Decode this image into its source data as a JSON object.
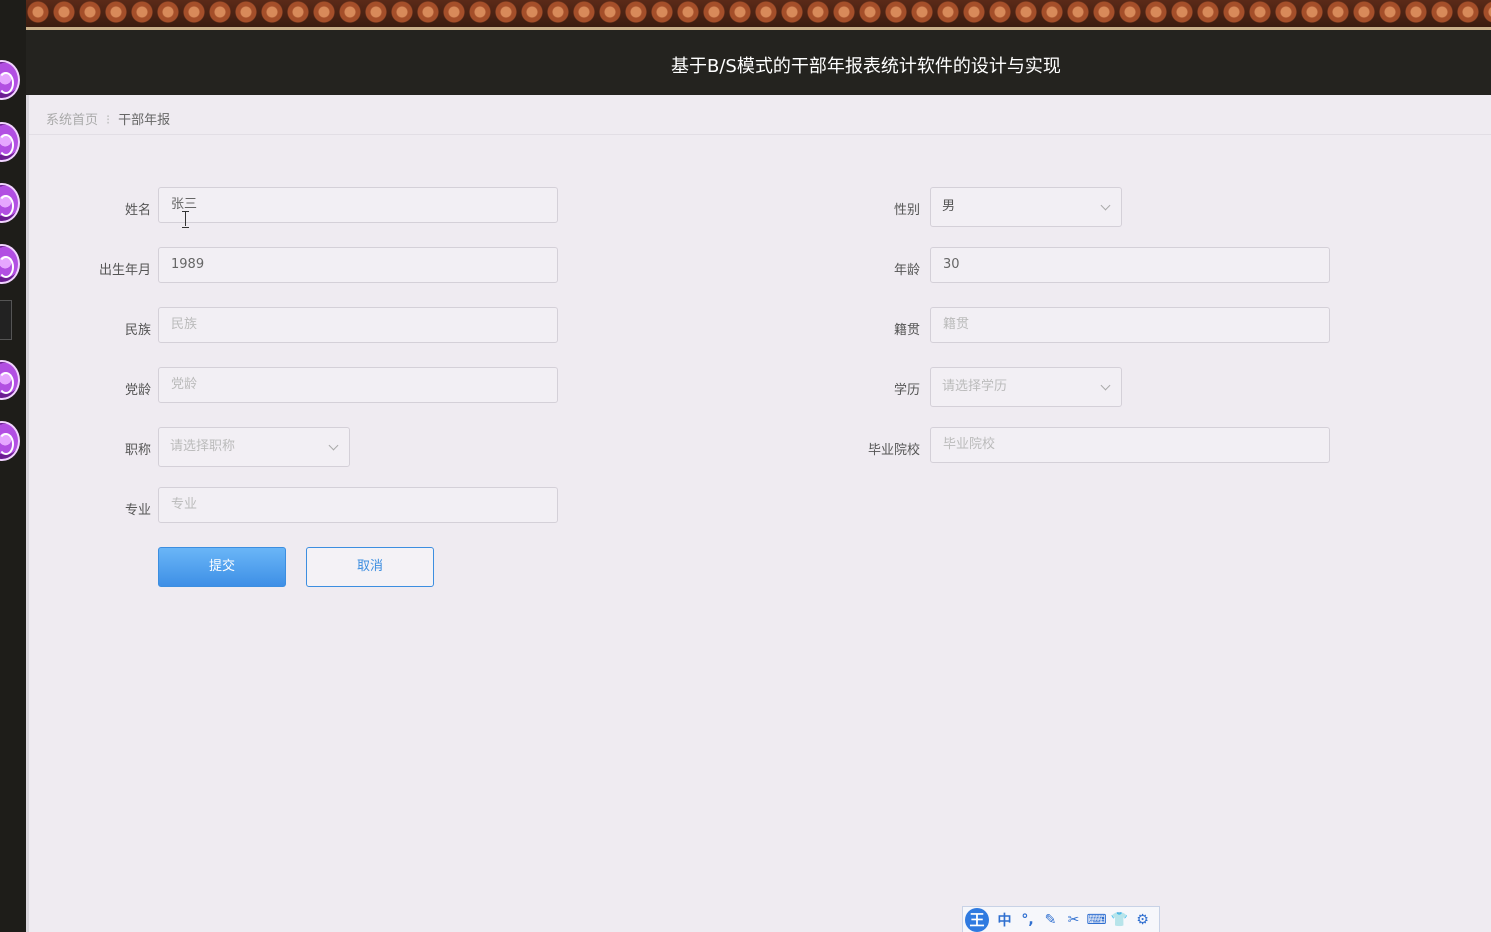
{
  "banner": {
    "title": "基于B/S模式的干部年报表统计软件的设计与实现"
  },
  "breadcrumb": {
    "home": "系统首页",
    "separator": "⁝",
    "current": "干部年报"
  },
  "form": {
    "name": {
      "label": "姓名",
      "value": "张三"
    },
    "gender": {
      "label": "性别",
      "value": "男"
    },
    "birth": {
      "label": "出生年月",
      "value": "1989"
    },
    "age": {
      "label": "年龄",
      "value": "30"
    },
    "ethnicity": {
      "label": "民族",
      "placeholder": "民族"
    },
    "native_place": {
      "label": "籍贯",
      "placeholder": "籍贯"
    },
    "party_age": {
      "label": "党龄",
      "placeholder": "党龄"
    },
    "education": {
      "label": "学历",
      "placeholder": "请选择学历"
    },
    "title": {
      "label": "职称",
      "placeholder": "请选择职称"
    },
    "school": {
      "label": "毕业院校",
      "placeholder": "毕业院校"
    },
    "major": {
      "label": "专业",
      "placeholder": "专业"
    },
    "submit_label": "提交",
    "cancel_label": "取消"
  },
  "ime_toolbar": {
    "logo": "王",
    "items": [
      "中",
      "°,",
      "✎",
      "✂",
      "⌨",
      "👕",
      "⚙"
    ]
  }
}
